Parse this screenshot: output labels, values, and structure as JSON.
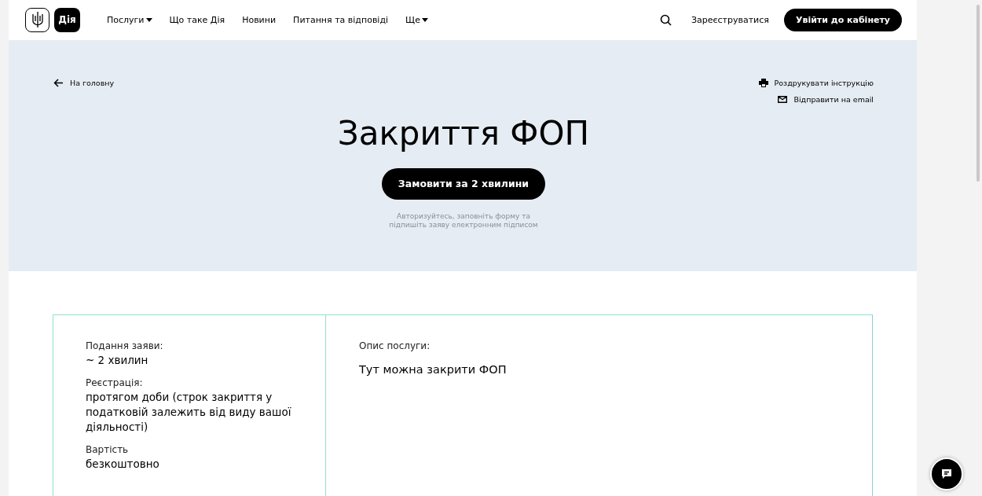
{
  "header": {
    "logo_text": "Дія",
    "nav": [
      {
        "label": "Послуги",
        "dropdown": true
      },
      {
        "label": "Що таке Дія",
        "dropdown": false
      },
      {
        "label": "Новини",
        "dropdown": false
      },
      {
        "label": "Питання та відповіді",
        "dropdown": false
      },
      {
        "label": "Ще",
        "dropdown": true
      }
    ],
    "register": "Зареєструватися",
    "login": "Увійти до кабінету"
  },
  "hero": {
    "back": "На головну",
    "actions": [
      {
        "kind": "print",
        "label": "Роздрукувати інструкцію"
      },
      {
        "kind": "email",
        "label": "Відправити на email"
      }
    ],
    "title": "Закриття ФОП",
    "cta": "Замовити за 2 хвилини",
    "note": "Авторизуйтесь, заповніть форму та підпишіть заяву електронним підписом"
  },
  "details": [
    {
      "label": "Подання заяви:",
      "value": "~ 2 хвилин"
    },
    {
      "label": "Реєстрація:",
      "value": "протягом доби (строк закриття у податковій залежить від виду вашої діяльності)"
    },
    {
      "label": "Вартість",
      "value": "безкоштовно"
    }
  ],
  "description": {
    "label": "Опис послуги:",
    "text": "Тут можна закрити ФОП"
  }
}
